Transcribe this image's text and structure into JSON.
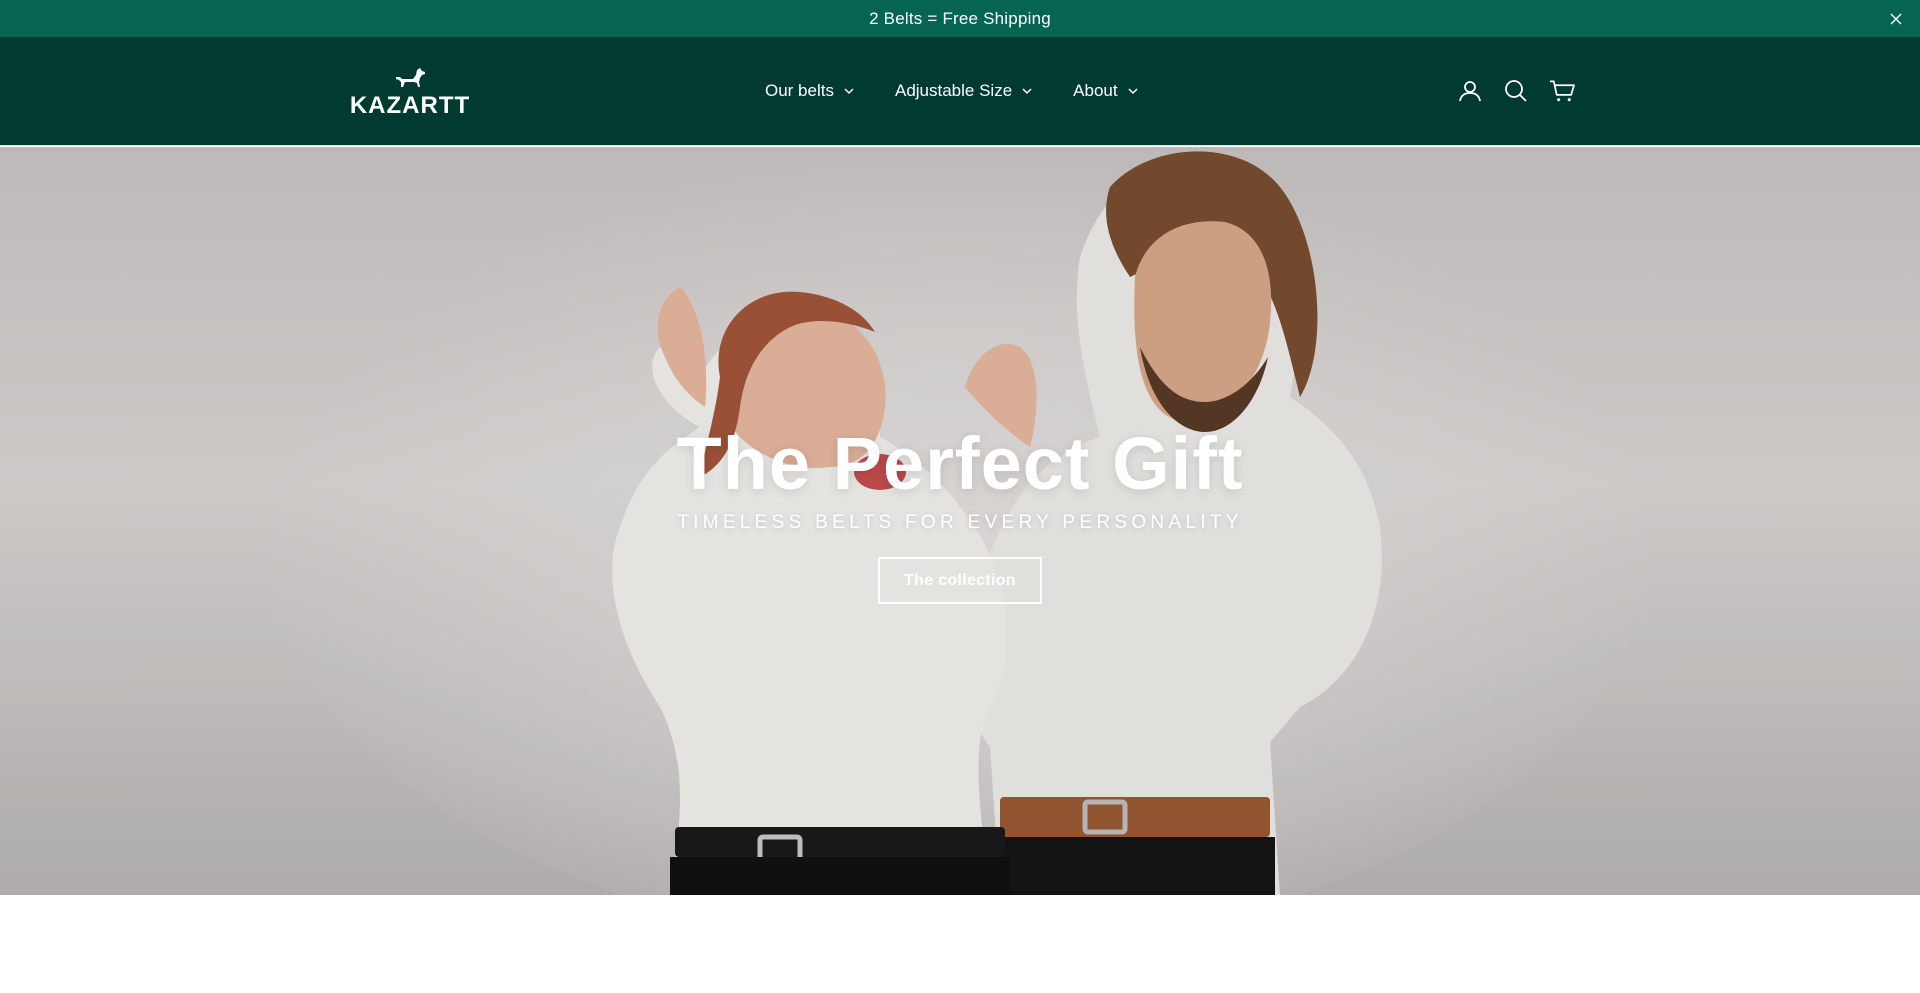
{
  "announcement": {
    "text": "2 Belts = Free Shipping",
    "close_icon": "close-icon"
  },
  "header": {
    "logo_text": "KAZARTT",
    "logo_icon": "dog-icon",
    "nav": [
      {
        "label": "Our belts",
        "icon": "chevron-down-icon"
      },
      {
        "label": "Adjustable Size",
        "icon": "chevron-down-icon"
      },
      {
        "label": "About",
        "icon": "chevron-down-icon"
      }
    ],
    "icons": [
      "account-icon",
      "search-icon",
      "cart-icon"
    ]
  },
  "hero": {
    "title": "The Perfect Gift",
    "subtitle": "TIMELESS BELTS FOR EVERY PERSONALITY",
    "button_label": "The collection"
  },
  "colors": {
    "announcement_bg": "#066452",
    "header_bg": "#003a31",
    "text_light": "#ffffff"
  }
}
